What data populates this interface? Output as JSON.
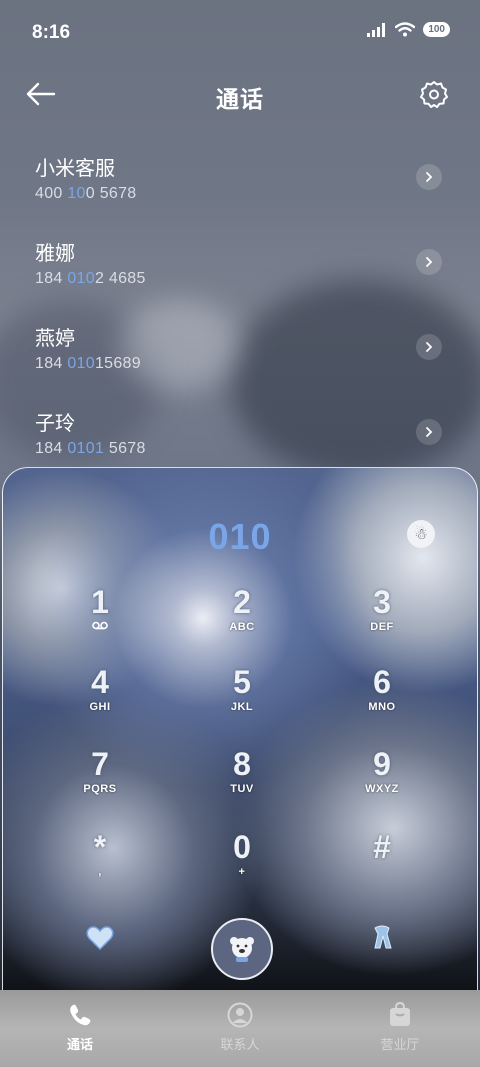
{
  "status": {
    "time": "8:16",
    "battery": "100"
  },
  "header": {
    "title": "通话"
  },
  "contacts": [
    {
      "name": "小米客服",
      "num_parts": [
        "400 ",
        "10",
        "0 5678"
      ],
      "chevron": "chevron-right-icon"
    },
    {
      "name": "雅娜",
      "num_parts": [
        "184 ",
        "010",
        "2 4685"
      ],
      "chevron": "chevron-right-icon"
    },
    {
      "name": "燕婷",
      "num_parts": [
        "184 ",
        "010",
        "15689"
      ],
      "chevron": "chevron-right-icon"
    },
    {
      "name": "子玲",
      "num_parts": [
        "184 ",
        "0101",
        " 5678"
      ],
      "chevron": "chevron-right-icon"
    }
  ],
  "dialpad": {
    "number": "010",
    "keys": [
      {
        "digit": "1",
        "letters": ""
      },
      {
        "digit": "2",
        "letters": "ABC"
      },
      {
        "digit": "3",
        "letters": "DEF"
      },
      {
        "digit": "4",
        "letters": "GHI"
      },
      {
        "digit": "5",
        "letters": "JKL"
      },
      {
        "digit": "6",
        "letters": "MNO"
      },
      {
        "digit": "7",
        "letters": "PQRS"
      },
      {
        "digit": "8",
        "letters": "TUV"
      },
      {
        "digit": "9",
        "letters": "WXYZ"
      },
      {
        "digit": "*",
        "letters": ","
      },
      {
        "digit": "0",
        "letters": "+"
      },
      {
        "digit": "#",
        "letters": ""
      }
    ]
  },
  "tabs": [
    {
      "label": "通话",
      "icon": "phone-icon",
      "active": true
    },
    {
      "label": "联系人",
      "icon": "contact-icon",
      "active": false
    },
    {
      "label": "营业厅",
      "icon": "bag-icon",
      "active": false
    }
  ],
  "colors": {
    "accent": "#7aa6e8"
  }
}
